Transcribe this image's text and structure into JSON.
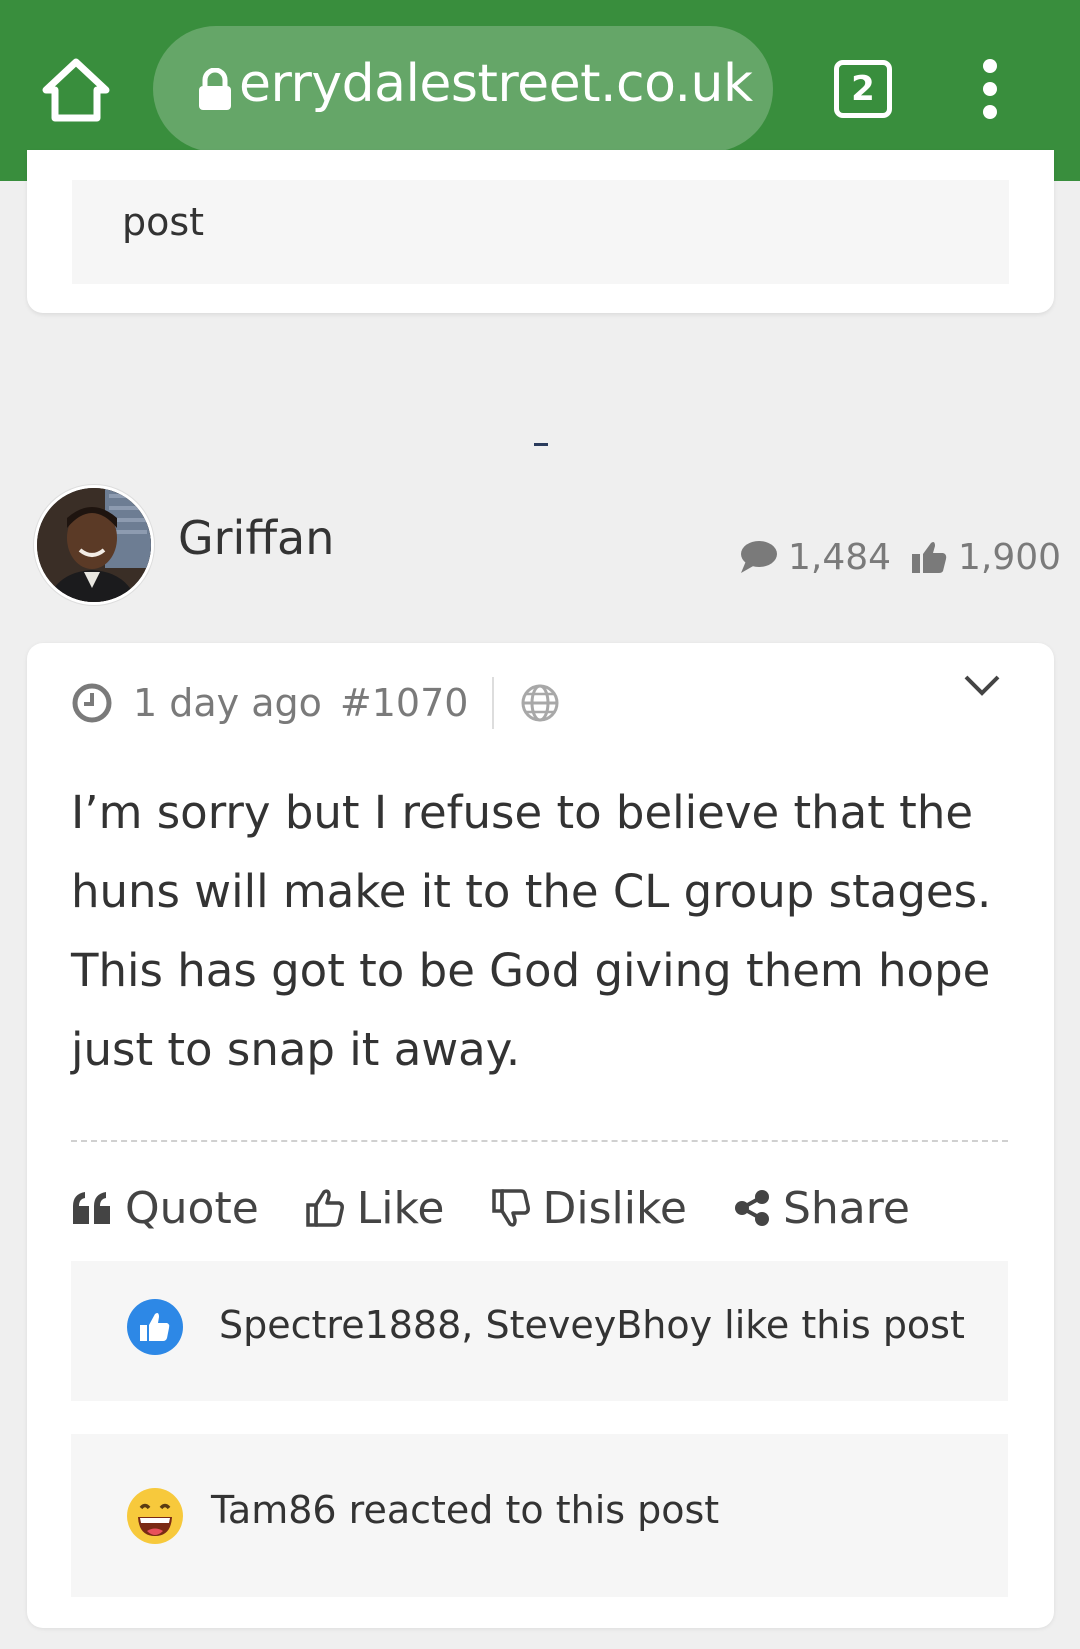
{
  "browser": {
    "url": "errydalestreet.co.uk",
    "tab_count": "2"
  },
  "previous_post": {
    "tail_text": "post"
  },
  "author": {
    "name": "Griffan",
    "comment_count": "1,484",
    "like_count": "1,900"
  },
  "post": {
    "time": "1 day ago",
    "number": "#1070",
    "body": "I’m sorry but I refuse to believe that the huns will make it to the CL group stages. This has got to be God giving them hope just to snap it away."
  },
  "actions": {
    "quote": "Quote",
    "like": "Like",
    "dislike": "Dislike",
    "share": "Share"
  },
  "reactions": {
    "likes_text": "Spectre1888, SteveyBhoy like this post",
    "reaction_text": "Tam86 reacted to this post"
  },
  "colors": {
    "toolbar": "#398e3d",
    "urlbar": "#65a668",
    "like_badge": "#2d88e6",
    "emoji": "#f7c93c"
  }
}
